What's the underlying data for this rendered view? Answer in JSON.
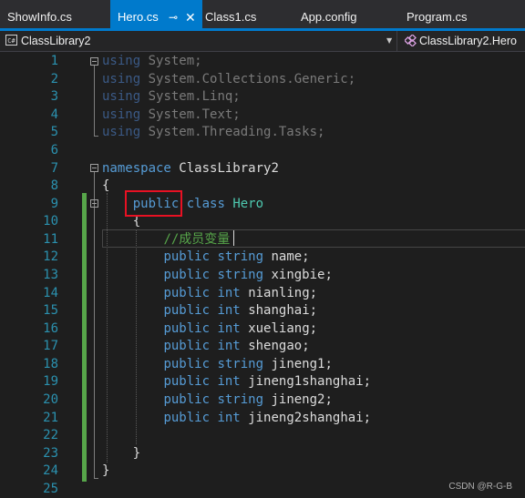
{
  "tabs": [
    {
      "label": "ShowInfo.cs"
    },
    {
      "label": "Hero.cs",
      "active": true
    },
    {
      "label": "Class1.cs"
    },
    {
      "label": "App.config"
    },
    {
      "label": "Program.cs"
    }
  ],
  "tab_pin_glyph": "⊸",
  "tab_close_glyph": "✕",
  "navbar": {
    "project": "ClassLibrary2",
    "project_icon": "C#",
    "member": "ClassLibrary2.Hero"
  },
  "line_numbers": [
    "1",
    "2",
    "3",
    "4",
    "5",
    "6",
    "7",
    "8",
    "9",
    "10",
    "11",
    "12",
    "13",
    "14",
    "15",
    "16",
    "17",
    "18",
    "19",
    "20",
    "21",
    "22",
    "23",
    "24",
    "25"
  ],
  "code": {
    "using_kw": "using",
    "using1": "System;",
    "using2": "System.Collections.Generic;",
    "using3": "System.Linq;",
    "using4": "System.Text;",
    "using5": "System.Threading.Tasks;",
    "namespace_kw": "namespace",
    "namespace_name": "ClassLibrary2",
    "open_brace": "{",
    "close_brace": "}",
    "public_kw": "public",
    "class_kw": "class",
    "class_name": "Hero",
    "comment": "//成员变量",
    "type_string": "string",
    "type_int": "int",
    "f12": "name;",
    "f13": "xingbie;",
    "f14": "nianling;",
    "f15": "shanghai;",
    "f16": "xueliang;",
    "f17": "shengao;",
    "f18": "jineng1;",
    "f19": "jineng1shanghai;",
    "f20": "jineng2;",
    "f21": "jineng2shanghai;"
  },
  "watermark": "CSDN @R-G-B"
}
